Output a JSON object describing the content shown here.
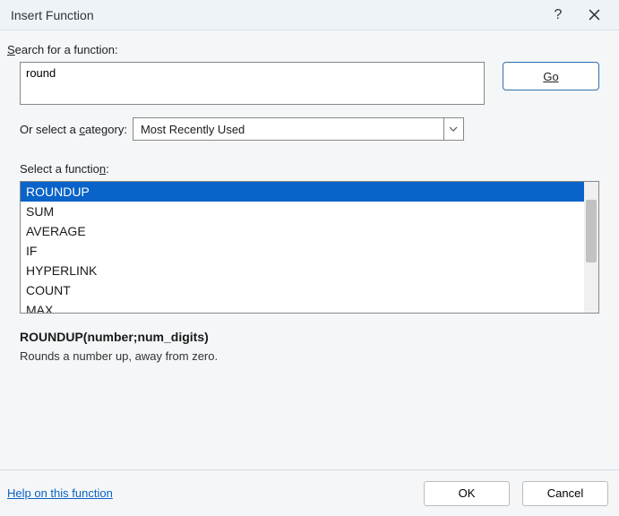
{
  "titlebar": {
    "title": "Insert Function"
  },
  "labels": {
    "search": "Search for a function:",
    "or_category": "Or select a category:",
    "select_func": "Select a function:"
  },
  "search": {
    "value": "round"
  },
  "buttons": {
    "go": "Go",
    "ok": "OK",
    "cancel": "Cancel"
  },
  "category": {
    "selected": "Most Recently Used"
  },
  "functions": {
    "items": [
      "ROUNDUP",
      "SUM",
      "AVERAGE",
      "IF",
      "HYPERLINK",
      "COUNT",
      "MAX"
    ],
    "selected_index": 0
  },
  "description": {
    "signature": "ROUNDUP(number;num_digits)",
    "text": "Rounds a number up, away from zero."
  },
  "footer": {
    "help": "Help on this function"
  }
}
